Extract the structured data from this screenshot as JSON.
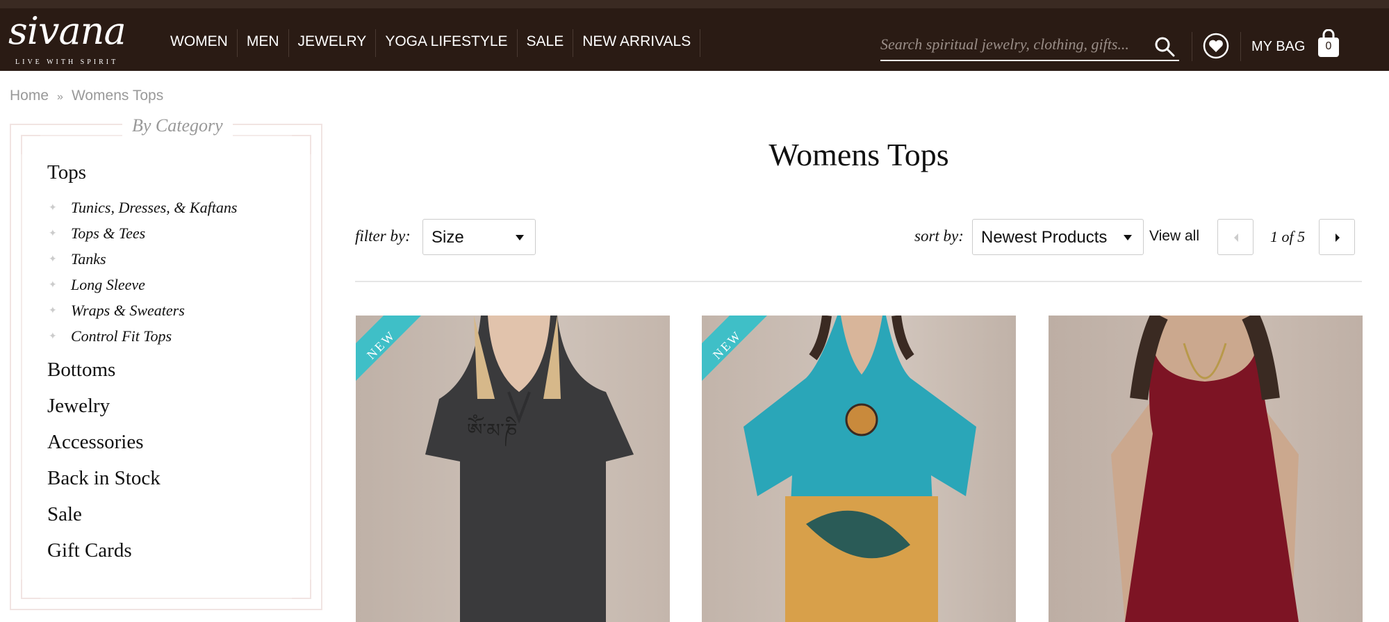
{
  "brand": {
    "logo_text": "sivana",
    "tagline": "LIVE WITH SPIRIT"
  },
  "nav": [
    "WOMEN",
    "MEN",
    "JEWELRY",
    "YOGA LIFESTYLE",
    "SALE",
    "NEW ARRIVALS"
  ],
  "search": {
    "placeholder": "Search spiritual jewelry, clothing, gifts..."
  },
  "bag": {
    "label": "MY BAG",
    "count": "0"
  },
  "breadcrumb": {
    "home": "Home",
    "sep": "»",
    "current": "Womens Tops"
  },
  "sidebar": {
    "title": "By Category",
    "categories": [
      {
        "label": "Tops",
        "sub": [
          "Tunics, Dresses, & Kaftans",
          "Tops & Tees",
          "Tanks",
          "Long Sleeve",
          "Wraps & Sweaters",
          "Control Fit Tops"
        ]
      },
      {
        "label": "Bottoms"
      },
      {
        "label": "Jewelry"
      },
      {
        "label": "Accessories"
      },
      {
        "label": "Back in Stock"
      },
      {
        "label": "Sale"
      },
      {
        "label": "Gift Cards"
      }
    ]
  },
  "main": {
    "title": "Womens Tops",
    "filter_label": "filter by:",
    "filter_value": "Size",
    "sort_label": "sort by:",
    "sort_value": "Newest Products",
    "view_all": "View all",
    "page_text": "1 of 5"
  },
  "products": [
    {
      "badge": "NEW",
      "image": "woman-gray-vneck-tee"
    },
    {
      "badge": "NEW",
      "image": "woman-butterfly-print-kaftan"
    },
    {
      "badge": "",
      "image": "woman-burgundy-tank"
    }
  ],
  "colors": {
    "header_bg": "#2a1b14",
    "ribbon": "#3fbfc7",
    "frame": "#f1e4e2"
  }
}
